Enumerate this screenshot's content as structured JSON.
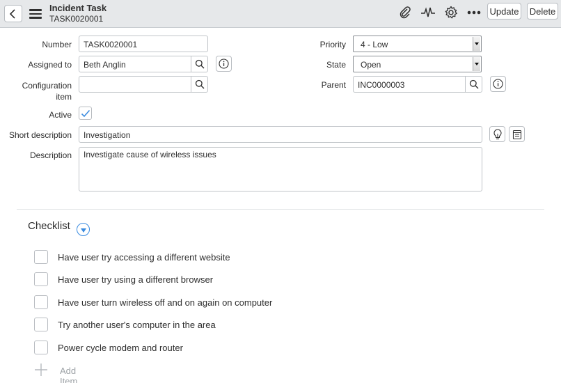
{
  "header": {
    "title": "Incident Task",
    "subtitle": "TASK0020001",
    "update_label": "Update",
    "delete_label": "Delete",
    "icons": [
      "back-icon",
      "menu-icon",
      "paperclip-icon",
      "activity-icon",
      "gear-icon",
      "more-icon"
    ]
  },
  "form": {
    "number": {
      "label": "Number",
      "value": "TASK0020001"
    },
    "assigned_to": {
      "label": "Assigned to",
      "value": "Beth Anglin"
    },
    "configuration_item": {
      "label_line1": "Configuration",
      "label_line2": "item",
      "value": ""
    },
    "active": {
      "label": "Active",
      "checked": true
    },
    "short_description": {
      "label": "Short description",
      "value": "Investigation"
    },
    "description": {
      "label": "Description",
      "value": "Investigate cause of wireless issues"
    },
    "priority": {
      "label": "Priority",
      "value": "4 - Low"
    },
    "state": {
      "label": "State",
      "value": "Open"
    },
    "parent": {
      "label": "Parent",
      "value": "INC0000003"
    }
  },
  "checklist": {
    "title": "Checklist",
    "items": [
      {
        "label": "Have user try accessing a different website",
        "checked": false
      },
      {
        "label": "Have user try using a different browser",
        "checked": false
      },
      {
        "label": "Have user turn wireless off and on again on computer",
        "checked": false
      },
      {
        "label": "Try another user's computer in the area",
        "checked": false
      },
      {
        "label": "Power cycle modem and router",
        "checked": false
      }
    ],
    "add_item_label": "Add Item"
  },
  "colors": {
    "header_bg": "#e6e8ea",
    "accent": "#3a8be0"
  }
}
